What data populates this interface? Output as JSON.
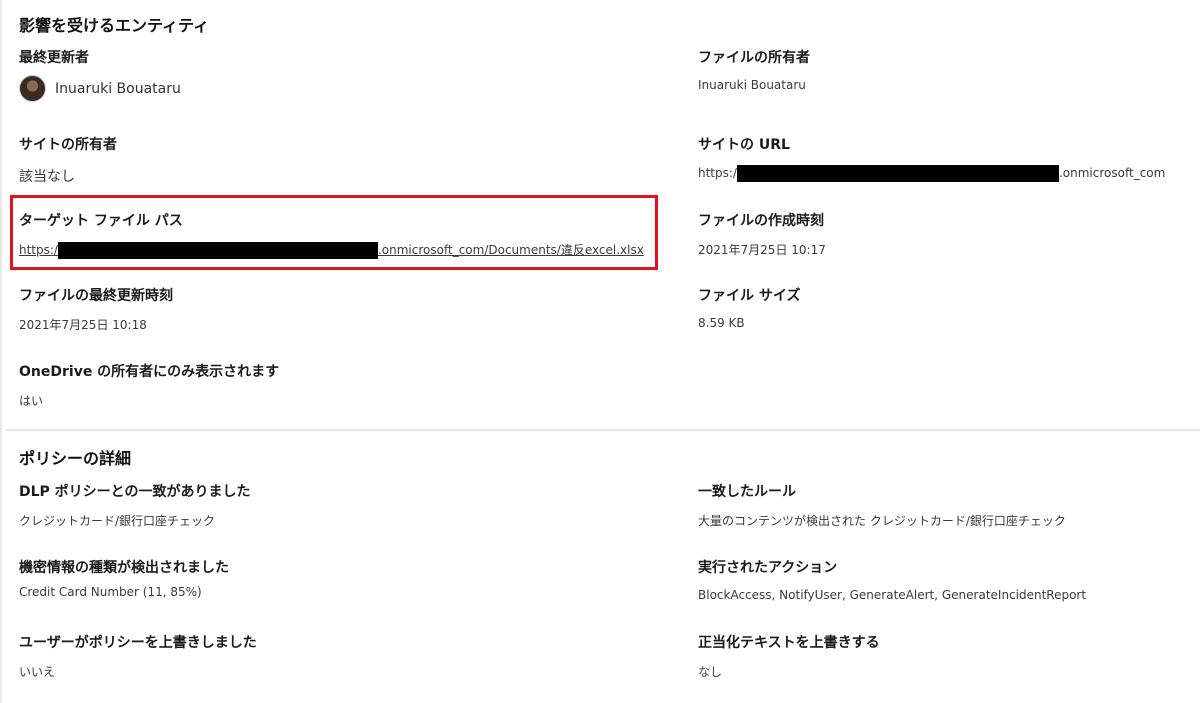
{
  "affected_entities": {
    "title": "影響を受けるエンティティ",
    "last_modified_by": {
      "label": "最終更新者",
      "user": "Inuaruki Bouataru"
    },
    "file_owner": {
      "label": "ファイルの所有者",
      "value": "Inuaruki Bouataru"
    },
    "site_owner": {
      "label": "サイトの所有者",
      "value": "該当なし"
    },
    "site_url": {
      "label": "サイトの URL",
      "prefix": "https:/",
      "suffix": ".onmicrosoft_com"
    },
    "target_file_path": {
      "label": "ターゲット ファイル パス",
      "prefix": "https:/",
      "suffix": ".onmicrosoft_com/Documents/違反excel.xlsx"
    },
    "file_created_time": {
      "label": "ファイルの作成時刻",
      "value": "2021年7月25日 10:17"
    },
    "file_last_modified_time": {
      "label": "ファイルの最終更新時刻",
      "value": "2021年7月25日 10:18"
    },
    "file_size": {
      "label": "ファイル サイズ",
      "value": "8.59 KB"
    },
    "onedrive_owner_only": {
      "label": "OneDrive の所有者にのみ表示されます",
      "value": "はい"
    }
  },
  "policy_details": {
    "title": "ポリシーの詳細",
    "dlp_match": {
      "label": "DLP ポリシーとの一致がありました",
      "value": "クレジットカード/銀行口座チェック"
    },
    "matched_rule": {
      "label": "一致したルール",
      "value": "大量のコンテンツが検出された クレジットカード/銀行口座チェック"
    },
    "sensitive_info": {
      "label": "機密情報の種類が検出されました",
      "value": "Credit Card Number (11, 85%)"
    },
    "actions_taken": {
      "label": "実行されたアクション",
      "value": "BlockAccess, NotifyUser, GenerateAlert, GenerateIncidentReport"
    },
    "user_override": {
      "label": "ユーザーがポリシーを上書きしました",
      "value": "いいえ"
    },
    "justification_override": {
      "label": "正当化テキストを上書きする",
      "value": "なし"
    }
  },
  "colors": {
    "highlight": "#e3121c",
    "redaction": "#000000"
  }
}
